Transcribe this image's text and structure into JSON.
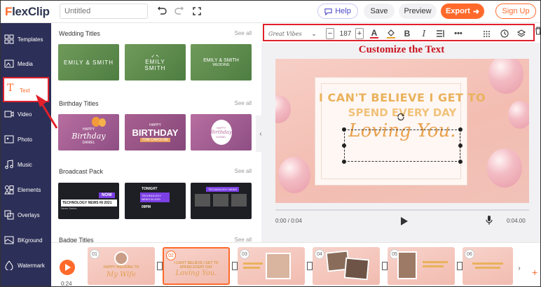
{
  "app": {
    "logo_initial": "F",
    "logo_rest": "lexClip",
    "project_title_placeholder": "Untitled"
  },
  "topbar": {
    "help_label": "Help",
    "save_label": "Save",
    "preview_label": "Preview",
    "export_label": "Export",
    "signup_label": "Sign Up"
  },
  "sidebar": {
    "items": [
      {
        "label": "Templates",
        "icon": "templates-icon"
      },
      {
        "label": "Media",
        "icon": "media-icon"
      },
      {
        "label": "Text",
        "icon": "text-icon"
      },
      {
        "label": "Video",
        "icon": "video-icon"
      },
      {
        "label": "Photo",
        "icon": "photo-icon"
      },
      {
        "label": "Music",
        "icon": "music-icon"
      },
      {
        "label": "Elements",
        "icon": "elements-icon"
      },
      {
        "label": "Overlays",
        "icon": "overlays-icon"
      },
      {
        "label": "BKground",
        "icon": "background-icon"
      },
      {
        "label": "Watermark",
        "icon": "watermark-icon"
      }
    ],
    "active": "Text"
  },
  "panel": {
    "sections": [
      {
        "title": "Wedding Titles",
        "see_all": "See all"
      },
      {
        "title": "Birthday Titles",
        "see_all": "See all"
      },
      {
        "title": "Broadcast Pack",
        "see_all": "See all"
      },
      {
        "title": "Badge Titles",
        "see_all": "See all"
      }
    ],
    "wedding": [
      {
        "line1": "EMILY & SMITH",
        "line2": ""
      },
      {
        "line1": "EMILY",
        "line2": "SMITH"
      },
      {
        "line1": "EMILY & SMITH",
        "line2": "WEDDING"
      }
    ],
    "birthday": [
      {
        "line1": "HAPPY",
        "line2": "Birthday",
        "line3": "DANIEL"
      },
      {
        "line1": "HAPPY",
        "line2": "BIRTHDAY",
        "line3": "TOM CAROLINE"
      },
      {
        "line1": "HAPPY",
        "line2": "Birthday",
        "line3": "DANIEL"
      }
    ],
    "broadcast": [
      {
        "tag": "NOW",
        "line1": "TECHNOLOGY NEWS IN 2021",
        "line2": "News Series"
      },
      {
        "tag": "TONIGHT",
        "line1": "TECHNOLOGY NEWS IN 2021",
        "line2": "09PM"
      },
      {
        "tag": "",
        "line1": "TECHNOLOGY NEWS",
        "line2": ""
      }
    ]
  },
  "toolbar": {
    "font_name": "Great Vibes",
    "font_size": "187",
    "minus": "−",
    "plus": "+"
  },
  "annotation": {
    "customize_label": "Customize the Text"
  },
  "canvas": {
    "line1": "I CAN'T BELIEVE I GET TO",
    "line2": "SPEND EVERY DAY",
    "line3": "Loving You."
  },
  "playback": {
    "current_time": "0:00 / 0:04",
    "duration": "0:04.00",
    "timeline_time": "0:24"
  },
  "timeline": {
    "scenes": [
      {
        "num": "01",
        "txt": "HAPPY WEDDING TO",
        "script": "My Wife"
      },
      {
        "num": "02",
        "txt": "I CAN'T BELIEVE I GET TO SPEND EVERY DAY",
        "script": "Loving You."
      },
      {
        "num": "03",
        "txt": "",
        "script": ""
      },
      {
        "num": "04",
        "txt": "",
        "script": ""
      },
      {
        "num": "05",
        "txt": "",
        "script": ""
      },
      {
        "num": "06",
        "txt": "",
        "script": ""
      }
    ]
  },
  "colors": {
    "accent": "#ff6a2b",
    "sidebar_bg": "#2c2f57",
    "highlight_red": "#e0212c",
    "title_gold": "#e9b25c"
  }
}
